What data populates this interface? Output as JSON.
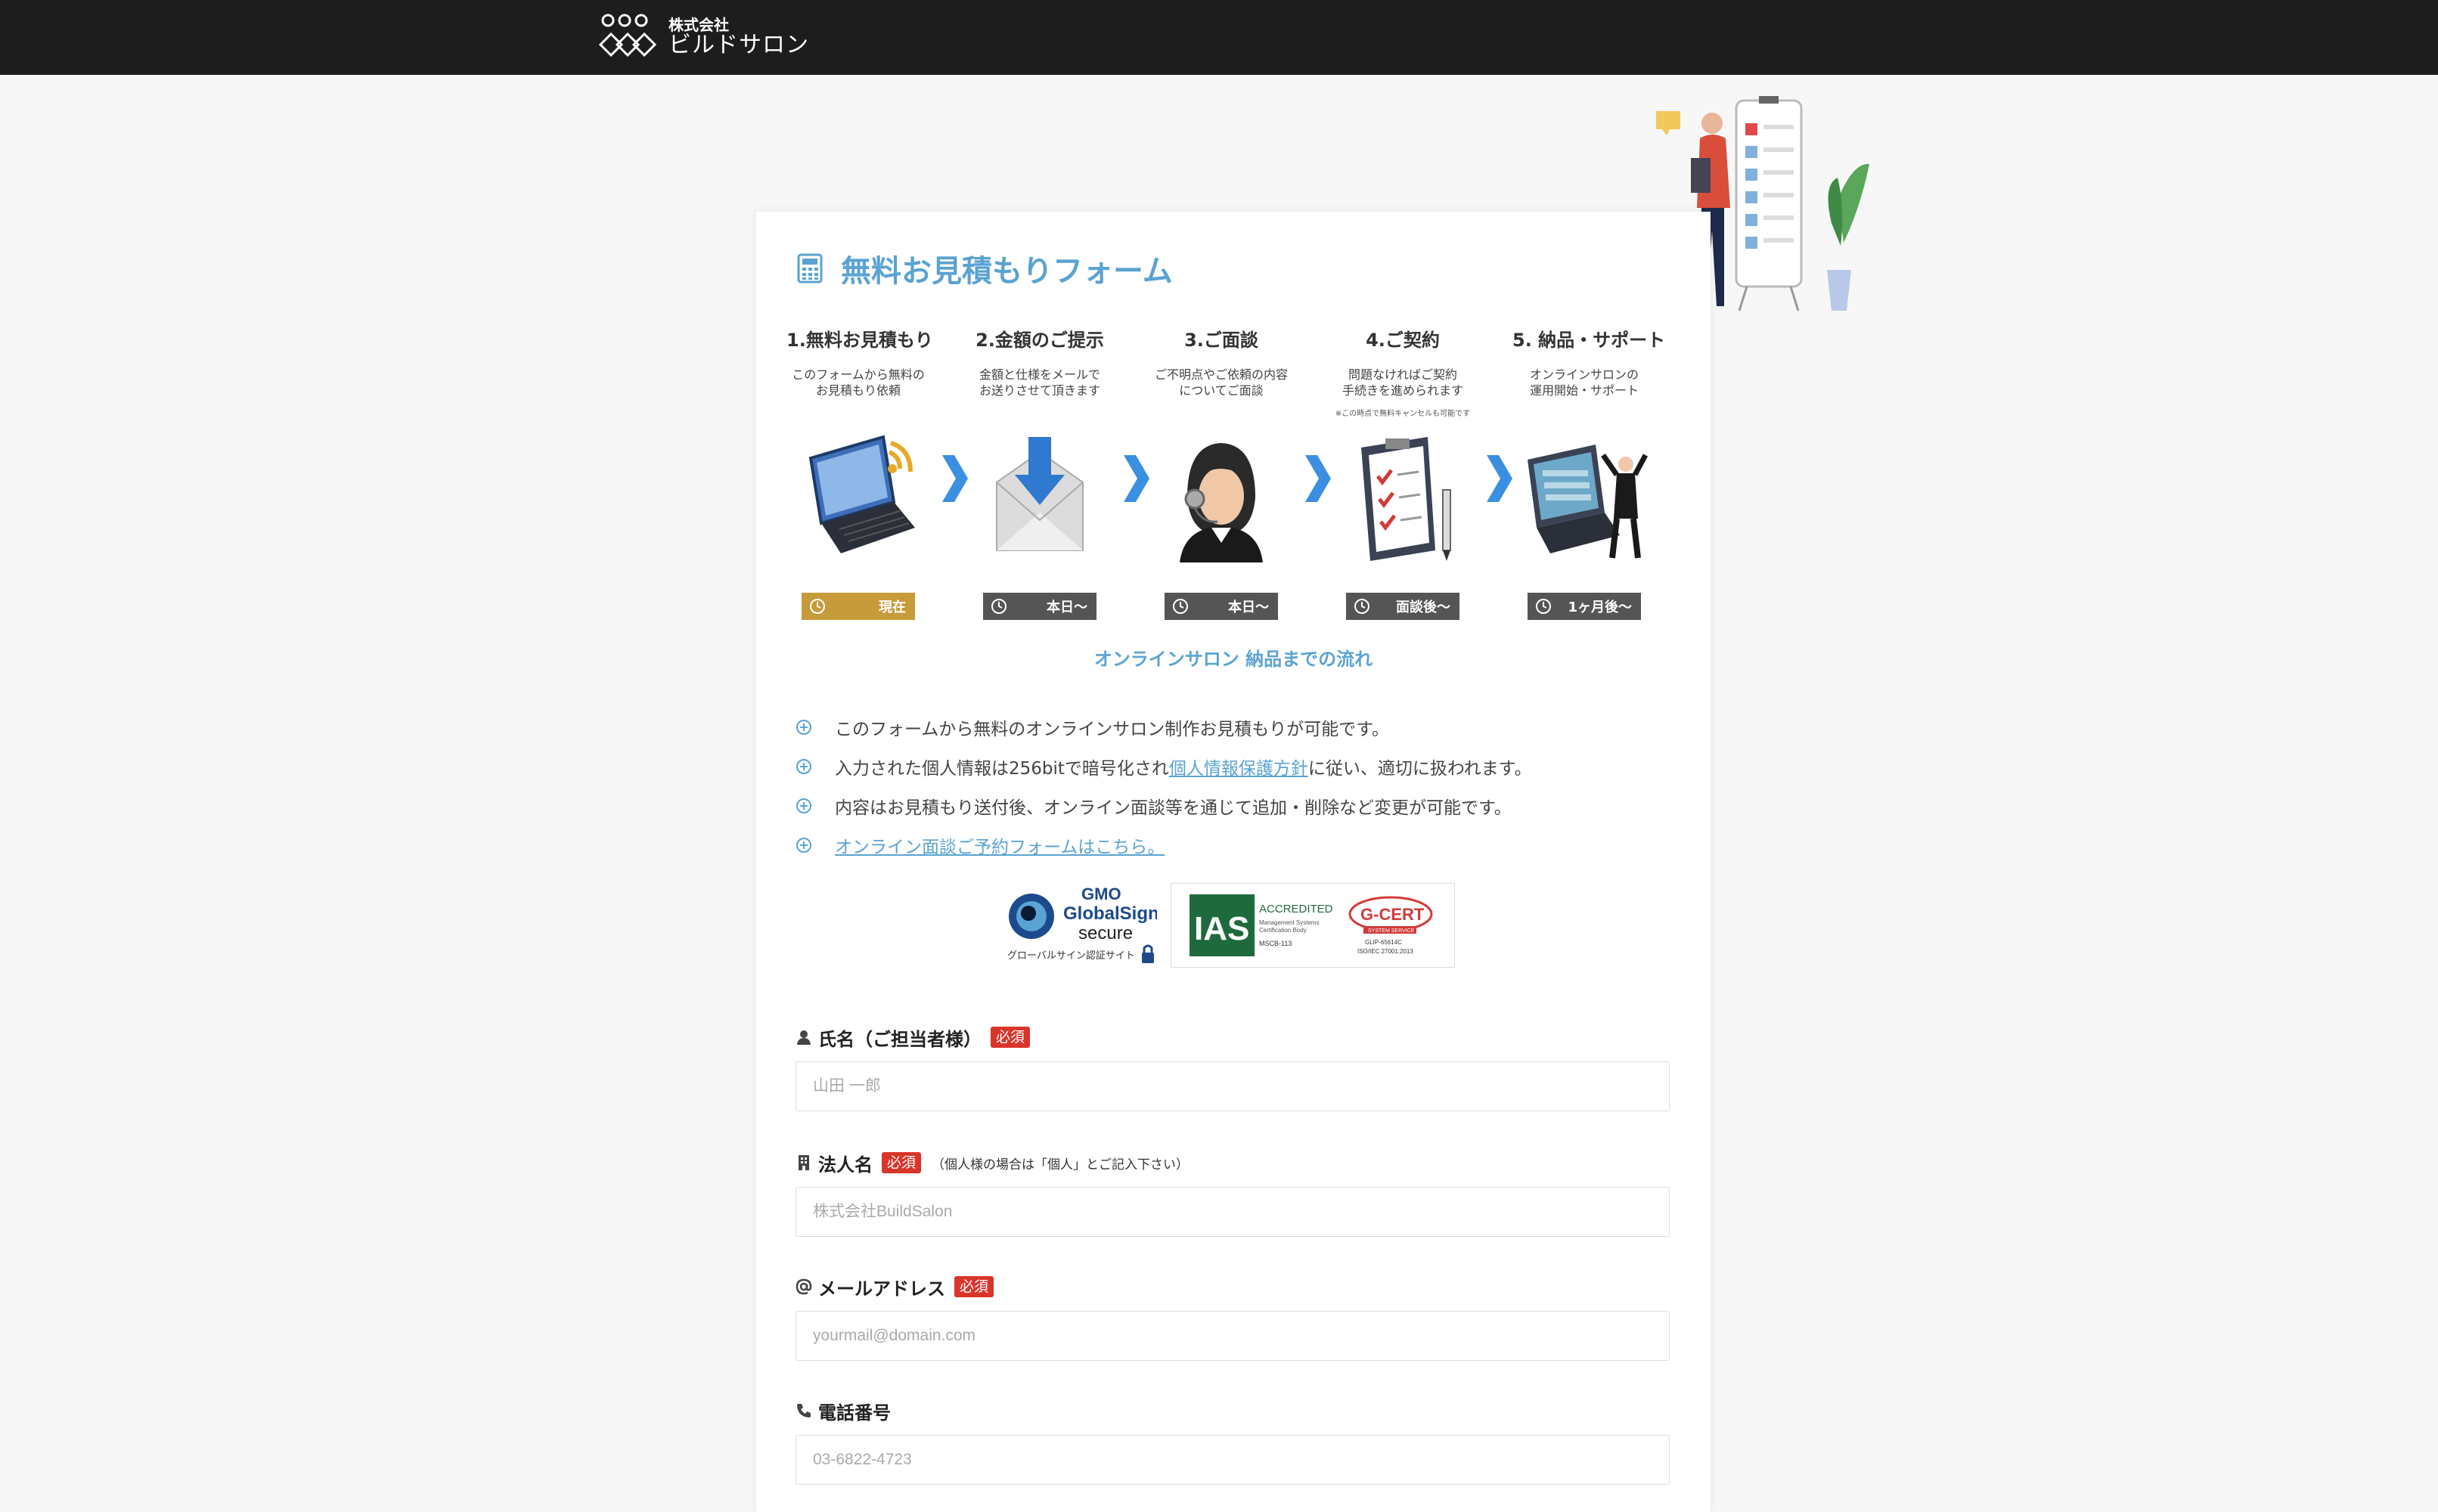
{
  "header": {
    "logo_small": "株式会社",
    "logo_main": "ビルドサロン"
  },
  "form": {
    "title": "無料お見積もりフォーム",
    "steps": [
      {
        "title": "1.無料お見積もり",
        "desc": "このフォームから無料の\nお見積もり依頼",
        "note": "",
        "badge": "現在",
        "current": true
      },
      {
        "title": "2.金額のご提示",
        "desc": "金額と仕様をメールで\nお送りさせて頂きます",
        "note": "",
        "badge": "本日〜",
        "current": false
      },
      {
        "title": "3.ご面談",
        "desc": "ご不明点やご依頼の内容\nについてご面談",
        "note": "",
        "badge": "本日〜",
        "current": false
      },
      {
        "title": "4.ご契約",
        "desc": "問題なければご契約\n手続きを進められます",
        "note": "※この時点で無料キャンセルも可能です",
        "badge": "面談後〜",
        "current": false
      },
      {
        "title": "5. 納品・サポート",
        "desc": "オンラインサロンの\n運用開始・サポート",
        "note": "",
        "badge": "1ヶ月後〜",
        "current": false
      }
    ],
    "flow_caption": "オンラインサロン 納品までの流れ",
    "notes": {
      "n1": "このフォームから無料のオンラインサロン制作お見積もりが可能です。",
      "n2_before": "入力された個人情報は256bitで暗号化され",
      "n2_link": "個人情報保護方針",
      "n2_after": "に従い、適切に扱われます。",
      "n3": "内容はお見積もり送付後、オンライン面談等を通じて追加・削除など変更が可能です。",
      "n4_link": "オンライン面談ご予約フォームはこちら。"
    },
    "security": {
      "gmo_brand": "GMO",
      "gmo_name": "GlobalSign",
      "gmo_secure": "secure",
      "gmo_caption": "グローバルサイン認証サイト",
      "ias_logo": "IAS",
      "ias_accredited": "ACCREDITED",
      "ias_sub1": "Management Systems",
      "ias_sub2": "Certification Body",
      "ias_code": "MSCB-113",
      "gcert_logo": "G-CERT",
      "gcert_service": "SYSTEM SERVICE",
      "gcert_code": "GLIP-65614C",
      "gcert_iso": "ISO/IEC 27001:2013"
    },
    "required_label": "必須",
    "fields": {
      "name": {
        "label": "氏名（ご担当者様）",
        "placeholder": "山田 一郎"
      },
      "company": {
        "label": "法人名",
        "note": "（個人様の場合は「個人」とご記入下さい）",
        "placeholder": "株式会社BuildSalon"
      },
      "email": {
        "label": "メールアドレス",
        "placeholder": "yourmail@domain.com"
      },
      "phone": {
        "label": "電話番号",
        "placeholder": "03-6822-4723"
      }
    }
  },
  "colors": {
    "accent": "#5aa3d2",
    "header_bg": "#1d1d1d",
    "required": "#d9352a",
    "current_badge": "#c79a3a",
    "badge": "#555555"
  },
  "icons": [
    "calculator-icon",
    "chevron-right-icon",
    "clock-icon",
    "plus-circle-icon",
    "user-icon",
    "building-icon",
    "at-icon",
    "phone-icon",
    "lock-icon"
  ]
}
